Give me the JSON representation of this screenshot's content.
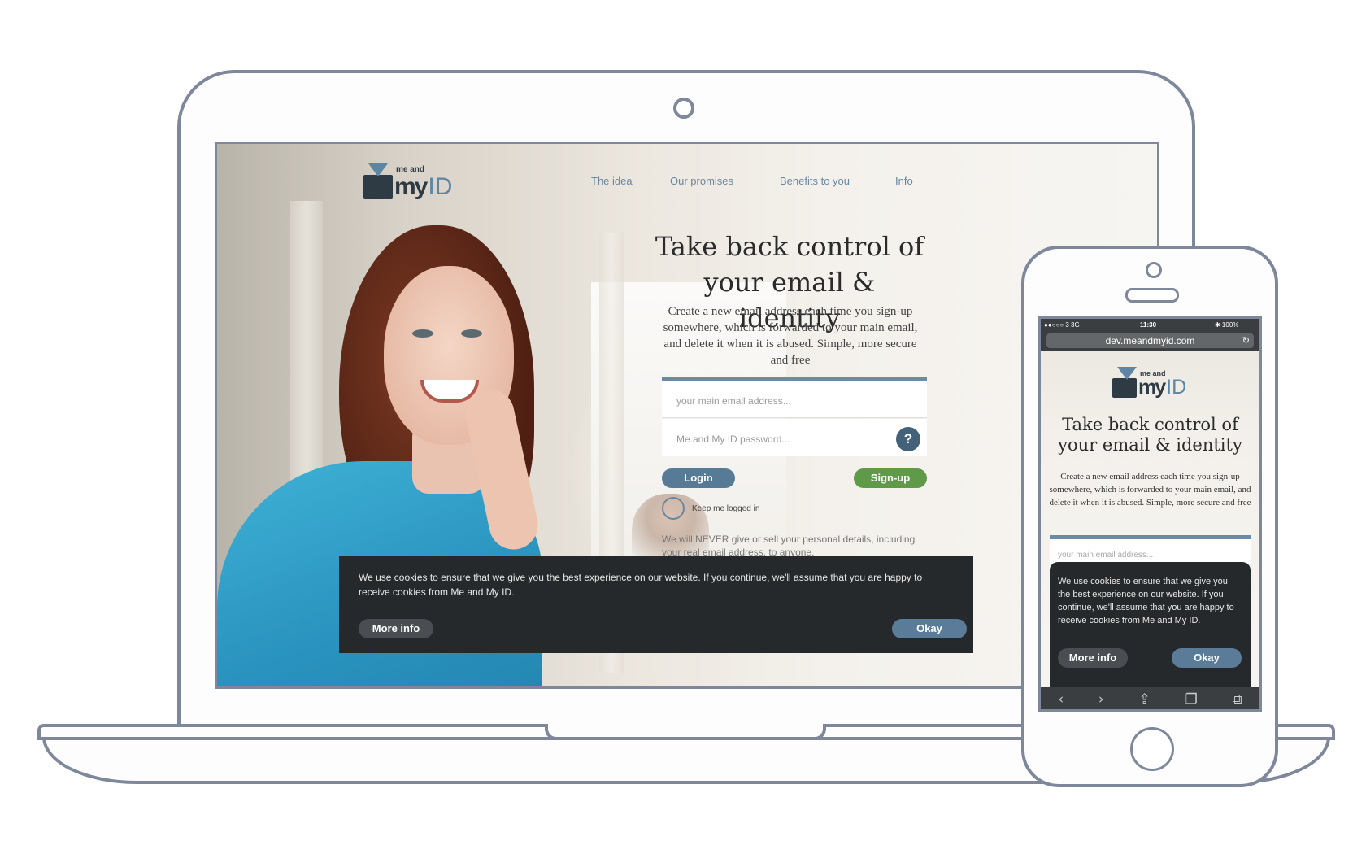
{
  "laptop": {
    "logo": {
      "small": "me and",
      "main": "my",
      "id": "ID"
    },
    "nav": [
      "The idea",
      "Our promises",
      "Benefits to you",
      "Info"
    ],
    "hero": {
      "title": "Take back control of your email & identity",
      "subtitle": "Create a new email address each time you sign-up somewhere, which is forwarded to your main email, and delete it when it is abused. Simple, more secure and free"
    },
    "form": {
      "email_placeholder": "your main email address...",
      "password_placeholder": "Me and My ID password...",
      "help_icon": "?",
      "login_label": "Login",
      "signup_label": "Sign-up",
      "keep_logged_in_label": "Keep me logged in",
      "never_text": "We will NEVER give or sell your personal details, including your real email address, to anyone."
    },
    "cookie": {
      "text": "We use cookies to ensure that we give you the best experience on our website. If you continue, we'll assume that you are happy to receive cookies from Me and My ID.",
      "more_info_label": "More info",
      "okay_label": "Okay"
    }
  },
  "phone": {
    "status": {
      "carrier": "●●○○○ 3  3G",
      "time": "11:30",
      "battery": "✱ 100%"
    },
    "url": "dev.meandmyid.com",
    "logo": {
      "small": "me and",
      "main": "my",
      "id": "ID"
    },
    "title": "Take back control of your email & identity",
    "subtitle": "Create a new email address each time you sign-up somewhere, which is forwarded to your main email, and delete it when it is abused. Simple, more secure and free",
    "email_placeholder": "your main email address...",
    "cookie": {
      "text": "We use cookies to ensure that we give you the best experience on our website. If you continue, we'll assume that you are happy to receive cookies from Me and My ID.",
      "more_info_label": "More info",
      "okay_label": "Okay"
    },
    "toolbar_icons": [
      "back-icon",
      "forward-icon",
      "share-icon",
      "bookmarks-icon",
      "tabs-icon"
    ]
  },
  "colors": {
    "accent": "#5b7c99",
    "signup": "#5e9a48",
    "dark": "#26292b",
    "outline": "#7e889a"
  }
}
